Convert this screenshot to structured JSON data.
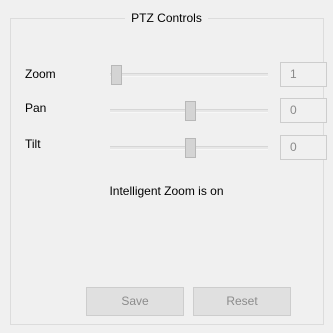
{
  "group": {
    "title": "PTZ Controls"
  },
  "controls": [
    {
      "label": "Zoom",
      "value": "1",
      "level": 0.0
    },
    {
      "label": "Pan",
      "value": "0",
      "level": 0.5
    },
    {
      "label": "Tilt",
      "value": "0",
      "level": 0.5
    }
  ],
  "status": {
    "text": "Intelligent Zoom is on"
  },
  "buttons": {
    "save_label": "Save",
    "reset_label": "Reset"
  }
}
